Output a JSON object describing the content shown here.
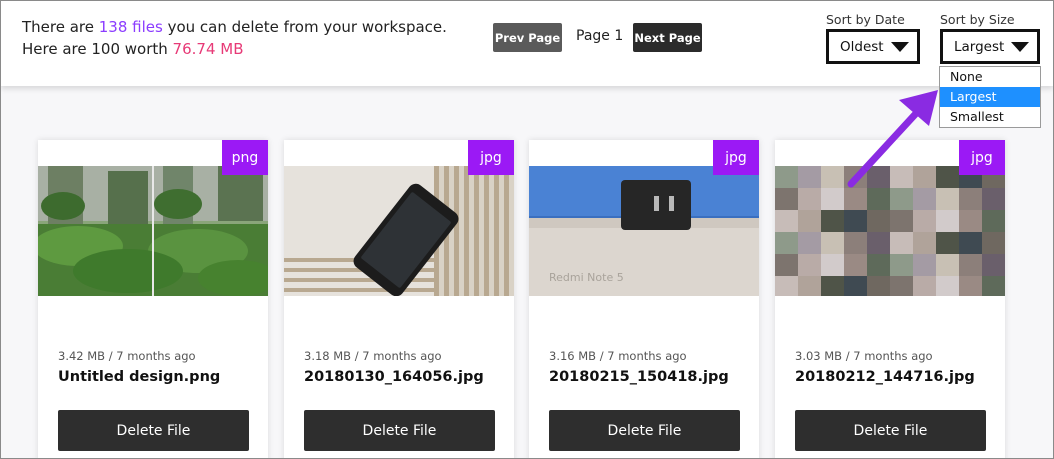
{
  "summary": {
    "line1_prefix": "There are ",
    "file_count": "138 files",
    "line1_suffix": " you can delete from your workspace.",
    "line2_prefix": "Here are 100 worth ",
    "total_size": "76.74 MB"
  },
  "pager": {
    "prev_label": "Prev Page",
    "page_label": "Page 1",
    "next_label": "Next Page"
  },
  "sort_date": {
    "label": "Sort by Date",
    "value": "Oldest"
  },
  "sort_size": {
    "label": "Sort by Size",
    "value": "Largest",
    "options": [
      "None",
      "Largest",
      "Smallest"
    ]
  },
  "cards": [
    {
      "badge": "png",
      "meta": "3.42 MB / 7 months ago",
      "name": "Untitled design.png",
      "delete_label": "Delete File"
    },
    {
      "badge": "jpg",
      "meta": "3.18 MB / 7 months ago",
      "name": "20180130_164056.jpg",
      "delete_label": "Delete File"
    },
    {
      "badge": "jpg",
      "meta": "3.16 MB / 7 months ago",
      "name": "20180215_150418.jpg",
      "delete_label": "Delete File"
    },
    {
      "badge": "jpg",
      "meta": "3.03 MB / 7 months ago",
      "name": "20180212_144716.jpg",
      "delete_label": "Delete File"
    }
  ],
  "thumb3_text": "Redmi Note 5",
  "colors": {
    "accent_purple": "#8b3cff",
    "size_pink": "#e73a77",
    "badge_purple": "#9b19f5",
    "arrow_purple": "#8a2be2",
    "selected_blue": "#1e90ff"
  }
}
